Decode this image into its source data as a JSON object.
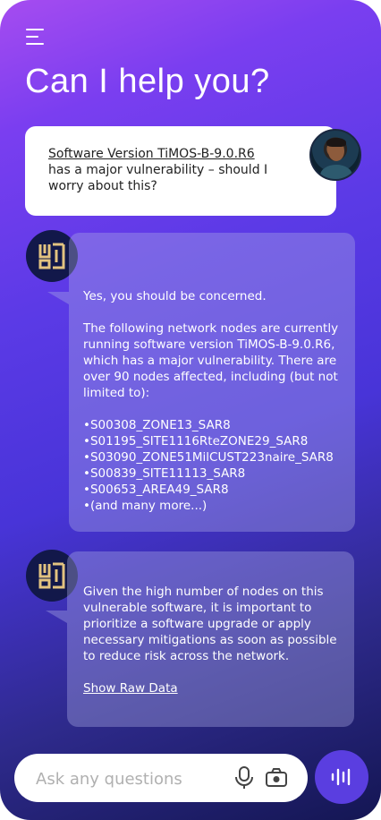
{
  "header": {
    "menu_icon": "hamburger-menu-icon",
    "title": "Can I help you?"
  },
  "user_message": {
    "link_text": "Software Version TiMOS-B-9.0.R6",
    "text": "has a major vulnerability – should I worry about this?",
    "avatar": "user-avatar"
  },
  "ai_message_1": {
    "icon": "assistant-logo-icon",
    "lead": "Yes, you should be concerned.",
    "body": "The following network nodes are currently running software version TiMOS-B-9.0.R6, which has a major vulnerability. There are over 90 nodes affected, including (but not limited to):",
    "nodes": [
      "•S00308_ZONE13_SAR8",
      "•S01195_SITE1116RteZONE29_SAR8",
      "•S03090_ZONE51MilCUST223naire_SAR8",
      "•S00839_SITE11113_SAR8",
      "•S00653_AREA49_SAR8",
      "•(and many more...)"
    ]
  },
  "ai_message_2": {
    "icon": "assistant-logo-icon",
    "body": "Given the high number of nodes on this vulnerable software, it is important to prioritize a software upgrade or apply necessary mitigations as soon as possible to reduce risk across the network.",
    "link": "Show Raw Data"
  },
  "composer": {
    "placeholder": "Ask any questions",
    "value": "",
    "mic_icon": "microphone-icon",
    "camera_icon": "camera-icon",
    "voice_icon": "voice-waveform-icon"
  },
  "colors": {
    "gradient_top": "#a64cf0",
    "gradient_mid": "#4834d8",
    "gradient_bottom": "#141653",
    "logo_bg": "#12184a",
    "logo_gold": "#e3c380",
    "voice_button": "#5a3ee0"
  }
}
